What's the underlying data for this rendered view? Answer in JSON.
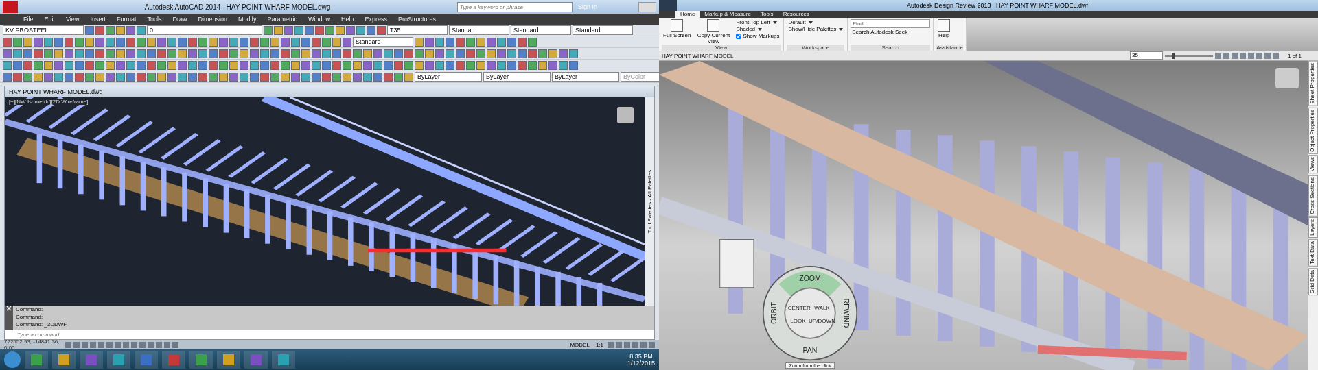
{
  "autocad": {
    "title": "Autodesk AutoCAD 2014",
    "file": "HAY POINT WHARF MODEL.dwg",
    "search": {
      "placeholder": "Type a keyword or phrase"
    },
    "sign_in": "Sign In",
    "menu": [
      "File",
      "Edit",
      "View",
      "Insert",
      "Format",
      "Tools",
      "Draw",
      "Dimension",
      "Modify",
      "Parametric",
      "Window",
      "Help",
      "Express",
      "ProStructures"
    ],
    "toolbar_fields": {
      "workspace": "KV PROSTEEL",
      "layer": "0",
      "text_style": "T35",
      "dim_style": "Standard",
      "table_style": "Standard",
      "multileader_style": "Standard",
      "visual_style": "Standard",
      "color_setting": "ByLayer",
      "linetype": "ByLayer",
      "lineweight": "ByLayer",
      "plot_style": "ByColor"
    },
    "document_tab": "HAY POINT WHARF MODEL.dwg",
    "viewport_label": "[−][NW Isometric][2D Wireframe]",
    "palette_label": "Tool Palettes - All Palettes",
    "command_history": [
      "Command:",
      "Command:",
      "Command:  _3DDWF"
    ],
    "command_input": {
      "placeholder": "Type a command"
    },
    "coordinates": "722552.93, -14841.36, 0.00",
    "model": "MODEL",
    "scale": "1:1"
  },
  "taskbar": {
    "time": "8:35 PM",
    "date": "1/12/2015"
  },
  "design_review": {
    "title": "Autodesk Design Review 2013",
    "file": "HAY POINT WHARF MODEL.dwf",
    "tabs": [
      {
        "label": "Home",
        "selected": true
      },
      {
        "label": "Markup & Measure",
        "selected": false
      },
      {
        "label": "Tools",
        "selected": false
      },
      {
        "label": "Resources",
        "selected": false
      }
    ],
    "ribbon": {
      "full_screen": "Full Screen",
      "copy_view": "Copy Current View",
      "view_name": "Front Top Left",
      "shading": "Shaded",
      "show_markups": {
        "label": "Show Markups",
        "checked": true
      },
      "view_panel": "View",
      "workspace": "Default",
      "palettes": "Show/Hide Palettes",
      "workspace_panel": "Workspace",
      "find": {
        "placeholder": "Find..."
      },
      "seek": "Search Autodesk Seek",
      "search_panel": "Search",
      "help": "Help",
      "assistance_panel": "Assistance"
    },
    "sheet_title": "HAY POINT WHARF MODEL",
    "zoom": "35",
    "zoom_slider": {
      "level": 0.15
    },
    "page": "1 of 1",
    "side_tabs": [
      "Sheet Properties",
      "Object Properties",
      "Views",
      "Cross Sections",
      "Layers",
      "Text Data",
      "Grid Data"
    ],
    "wheel": {
      "zoom": "ZOOM",
      "center": "CENTER",
      "walk": "WALK",
      "rewind": "REWIND",
      "orbit": "ORBIT",
      "look": "LOOK",
      "updown": "UP/DOWN",
      "pan": "PAN",
      "tooltip": "Zoom from the click"
    }
  }
}
